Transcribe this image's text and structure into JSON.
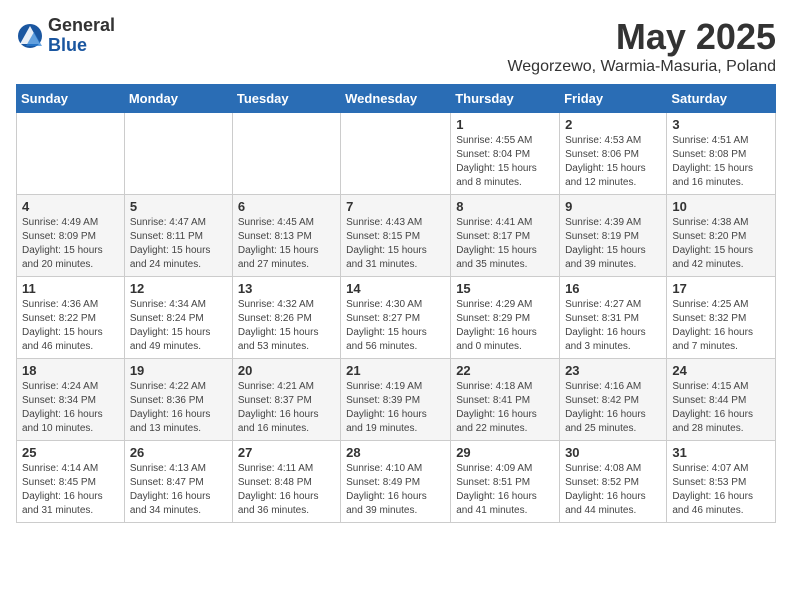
{
  "logo": {
    "general": "General",
    "blue": "Blue"
  },
  "title": "May 2025",
  "location": "Wegorzewo, Warmia-Masuria, Poland",
  "weekdays": [
    "Sunday",
    "Monday",
    "Tuesday",
    "Wednesday",
    "Thursday",
    "Friday",
    "Saturday"
  ],
  "weeks": [
    [
      {
        "day": "",
        "info": ""
      },
      {
        "day": "",
        "info": ""
      },
      {
        "day": "",
        "info": ""
      },
      {
        "day": "",
        "info": ""
      },
      {
        "day": "1",
        "info": "Sunrise: 4:55 AM\nSunset: 8:04 PM\nDaylight: 15 hours\nand 8 minutes."
      },
      {
        "day": "2",
        "info": "Sunrise: 4:53 AM\nSunset: 8:06 PM\nDaylight: 15 hours\nand 12 minutes."
      },
      {
        "day": "3",
        "info": "Sunrise: 4:51 AM\nSunset: 8:08 PM\nDaylight: 15 hours\nand 16 minutes."
      }
    ],
    [
      {
        "day": "4",
        "info": "Sunrise: 4:49 AM\nSunset: 8:09 PM\nDaylight: 15 hours\nand 20 minutes."
      },
      {
        "day": "5",
        "info": "Sunrise: 4:47 AM\nSunset: 8:11 PM\nDaylight: 15 hours\nand 24 minutes."
      },
      {
        "day": "6",
        "info": "Sunrise: 4:45 AM\nSunset: 8:13 PM\nDaylight: 15 hours\nand 27 minutes."
      },
      {
        "day": "7",
        "info": "Sunrise: 4:43 AM\nSunset: 8:15 PM\nDaylight: 15 hours\nand 31 minutes."
      },
      {
        "day": "8",
        "info": "Sunrise: 4:41 AM\nSunset: 8:17 PM\nDaylight: 15 hours\nand 35 minutes."
      },
      {
        "day": "9",
        "info": "Sunrise: 4:39 AM\nSunset: 8:19 PM\nDaylight: 15 hours\nand 39 minutes."
      },
      {
        "day": "10",
        "info": "Sunrise: 4:38 AM\nSunset: 8:20 PM\nDaylight: 15 hours\nand 42 minutes."
      }
    ],
    [
      {
        "day": "11",
        "info": "Sunrise: 4:36 AM\nSunset: 8:22 PM\nDaylight: 15 hours\nand 46 minutes."
      },
      {
        "day": "12",
        "info": "Sunrise: 4:34 AM\nSunset: 8:24 PM\nDaylight: 15 hours\nand 49 minutes."
      },
      {
        "day": "13",
        "info": "Sunrise: 4:32 AM\nSunset: 8:26 PM\nDaylight: 15 hours\nand 53 minutes."
      },
      {
        "day": "14",
        "info": "Sunrise: 4:30 AM\nSunset: 8:27 PM\nDaylight: 15 hours\nand 56 minutes."
      },
      {
        "day": "15",
        "info": "Sunrise: 4:29 AM\nSunset: 8:29 PM\nDaylight: 16 hours\nand 0 minutes."
      },
      {
        "day": "16",
        "info": "Sunrise: 4:27 AM\nSunset: 8:31 PM\nDaylight: 16 hours\nand 3 minutes."
      },
      {
        "day": "17",
        "info": "Sunrise: 4:25 AM\nSunset: 8:32 PM\nDaylight: 16 hours\nand 7 minutes."
      }
    ],
    [
      {
        "day": "18",
        "info": "Sunrise: 4:24 AM\nSunset: 8:34 PM\nDaylight: 16 hours\nand 10 minutes."
      },
      {
        "day": "19",
        "info": "Sunrise: 4:22 AM\nSunset: 8:36 PM\nDaylight: 16 hours\nand 13 minutes."
      },
      {
        "day": "20",
        "info": "Sunrise: 4:21 AM\nSunset: 8:37 PM\nDaylight: 16 hours\nand 16 minutes."
      },
      {
        "day": "21",
        "info": "Sunrise: 4:19 AM\nSunset: 8:39 PM\nDaylight: 16 hours\nand 19 minutes."
      },
      {
        "day": "22",
        "info": "Sunrise: 4:18 AM\nSunset: 8:41 PM\nDaylight: 16 hours\nand 22 minutes."
      },
      {
        "day": "23",
        "info": "Sunrise: 4:16 AM\nSunset: 8:42 PM\nDaylight: 16 hours\nand 25 minutes."
      },
      {
        "day": "24",
        "info": "Sunrise: 4:15 AM\nSunset: 8:44 PM\nDaylight: 16 hours\nand 28 minutes."
      }
    ],
    [
      {
        "day": "25",
        "info": "Sunrise: 4:14 AM\nSunset: 8:45 PM\nDaylight: 16 hours\nand 31 minutes."
      },
      {
        "day": "26",
        "info": "Sunrise: 4:13 AM\nSunset: 8:47 PM\nDaylight: 16 hours\nand 34 minutes."
      },
      {
        "day": "27",
        "info": "Sunrise: 4:11 AM\nSunset: 8:48 PM\nDaylight: 16 hours\nand 36 minutes."
      },
      {
        "day": "28",
        "info": "Sunrise: 4:10 AM\nSunset: 8:49 PM\nDaylight: 16 hours\nand 39 minutes."
      },
      {
        "day": "29",
        "info": "Sunrise: 4:09 AM\nSunset: 8:51 PM\nDaylight: 16 hours\nand 41 minutes."
      },
      {
        "day": "30",
        "info": "Sunrise: 4:08 AM\nSunset: 8:52 PM\nDaylight: 16 hours\nand 44 minutes."
      },
      {
        "day": "31",
        "info": "Sunrise: 4:07 AM\nSunset: 8:53 PM\nDaylight: 16 hours\nand 46 minutes."
      }
    ]
  ]
}
